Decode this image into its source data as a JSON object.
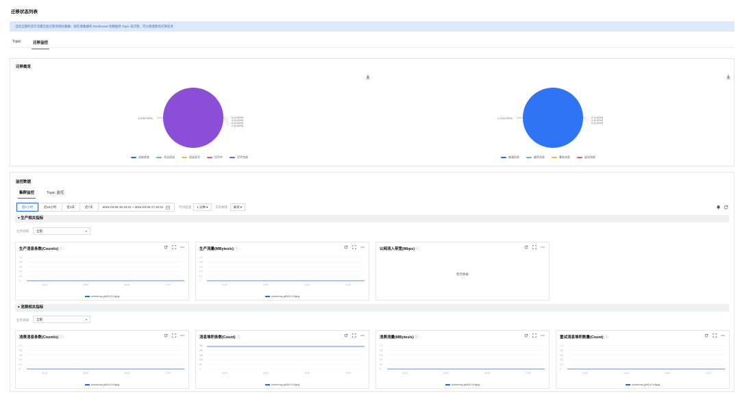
{
  "page": {
    "title": "迁移状态列表",
    "notice": "当前全部的读写流量已经迁移到目标集群，如在源集群的 Dashboard 有数据的 Topic 未迁移，可以新建新的迁移任务"
  },
  "tabs": [
    {
      "label": "Topic",
      "active": false
    },
    {
      "label": "迁移监控",
      "active": true
    }
  ],
  "overview": {
    "title": "迁移概览",
    "pies": [
      {
        "color": "#8a4fd6",
        "main_label": "1 (100.00%)",
        "zero_labels": [
          "0 (0.00%)",
          "0 (0.00%)",
          "0 (0.00%)",
          "0 (0.00%)"
        ],
        "legend": [
          {
            "label": "初始状态",
            "color": "#1e6be6"
          },
          {
            "label": "开启双读",
            "color": "#52c99a"
          },
          {
            "label": "双读双写",
            "color": "#f5b940"
          },
          {
            "label": "切写中",
            "color": "#e85a4f"
          },
          {
            "label": "切写完成",
            "color": "#8a4fd6"
          }
        ]
      },
      {
        "color": "#2f74f5",
        "main_label": "1 (100.00%)",
        "zero_labels": [
          "0 (0.00%)",
          "0 (0.00%)",
          "0 (0.00%)"
        ],
        "legend": [
          {
            "label": "普通消息",
            "color": "#1e6be6"
          },
          {
            "label": "顺序消息",
            "color": "#52c99a"
          },
          {
            "label": "事务消息",
            "color": "#f5b940"
          },
          {
            "label": "延时消息",
            "color": "#e85a4f"
          }
        ]
      }
    ]
  },
  "monitor": {
    "title": "监控数据",
    "subtabs": [
      {
        "label": "集群监控",
        "active": true
      },
      {
        "label": "Topic 监控",
        "active": false
      }
    ],
    "ranges": [
      {
        "label": "近1小时",
        "active": true
      },
      {
        "label": "近24小时",
        "active": false
      },
      {
        "label": "近3天",
        "active": false
      },
      {
        "label": "近7天",
        "active": false
      }
    ],
    "date_range": "2024-03-05 16:10:31  ~  2024-03-05 17:10:31",
    "granularity_label": "时间粒度",
    "granularity_value": "1 分钟 ▾",
    "refresh_label": "实时刷新",
    "refresh_value": "关闭 ▾",
    "sections": [
      {
        "title": "生产相关指标",
        "filter_label": "业务领域",
        "filter_value": "全部",
        "charts": [
          {
            "title": "生产消息条数(Count/s)",
            "legend": "rocketmq-g842z7v3g4g",
            "empty": false,
            "flat_at_top": false
          },
          {
            "title": "生产流量(MBytes/s)",
            "legend": "rocketmq-g842z7v3g4g",
            "empty": false,
            "flat_at_top": false
          },
          {
            "title": "公网流入带宽(Mbps)",
            "legend": "",
            "empty": true,
            "empty_text": "暂无数据"
          }
        ]
      },
      {
        "title": "消费相关指标",
        "filter_label": "业务领域",
        "filter_value": "全部",
        "charts": [
          {
            "title": "消费消息条数(Count/s)",
            "legend": "rocketmq-g842z7v3g4g",
            "empty": false,
            "flat_at_top": false
          },
          {
            "title": "消息堆积条数(Count)",
            "legend": "rocketmq-g842z7v3g4g",
            "empty": false,
            "flat_at_top": true
          },
          {
            "title": "消费流量(MBytes/s)",
            "legend": "rocketmq-g842z7v3g4g",
            "empty": false,
            "flat_at_top": false
          },
          {
            "title": "重试消息堆积数量(Count)",
            "legend": "rocketmq-g842z7v3g4g",
            "empty": false,
            "flat_at_top": false
          }
        ]
      }
    ],
    "x_ticks": [
      "16:15",
      "16:30",
      "16:45",
      "17:00"
    ],
    "y_ticks": [
      "1.0",
      "0.8",
      "0.6",
      "0.4",
      "0.2",
      "0"
    ],
    "y_ticks_stock": [
      "300",
      "240",
      "180",
      "120",
      "60",
      "0"
    ],
    "series_color": "#1e6be6"
  },
  "icons": {
    "download": "download-icon",
    "refresh": "refresh-icon",
    "fullscreen": "fullscreen-icon",
    "more": "more-icon",
    "info": "info-icon",
    "calendar": "calendar-icon",
    "bell": "bell-icon"
  }
}
